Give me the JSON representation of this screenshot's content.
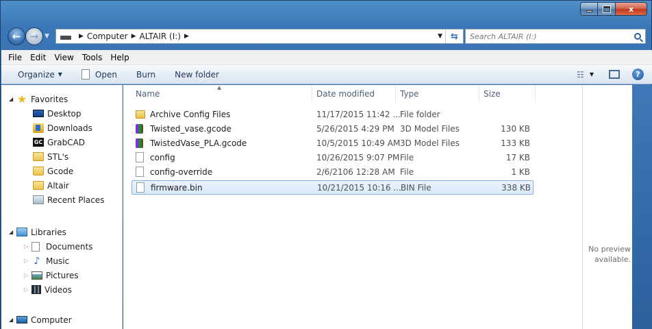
{
  "window": {
    "caption": {
      "minimize": "",
      "maximize": "",
      "close": "x"
    }
  },
  "address": {
    "crumbs": [
      "Computer",
      "ALTAIR (I:)"
    ],
    "search_placeholder": "Search ALTAIR (I:)"
  },
  "menu": [
    "File",
    "Edit",
    "View",
    "Tools",
    "Help"
  ],
  "toolbar": {
    "organize": "Organize",
    "open": "Open",
    "burn": "Burn",
    "new_folder": "New folder",
    "help": "?"
  },
  "nav": {
    "favorites_label": "Favorites",
    "favorites": [
      {
        "label": "Desktop",
        "icon": "desktop-icon"
      },
      {
        "label": "Downloads",
        "icon": "downloads-icon"
      },
      {
        "label": "GrabCAD",
        "icon": "grabcad-icon",
        "badge": "GC"
      },
      {
        "label": "STL's",
        "icon": "folder-icon"
      },
      {
        "label": "Gcode",
        "icon": "folder-icon"
      },
      {
        "label": "Altair",
        "icon": "folder-icon"
      },
      {
        "label": "Recent Places",
        "icon": "recent-places-icon"
      }
    ],
    "libraries_label": "Libraries",
    "libraries": [
      {
        "label": "Documents",
        "icon": "documents-icon"
      },
      {
        "label": "Music",
        "icon": "music-icon"
      },
      {
        "label": "Pictures",
        "icon": "pictures-icon"
      },
      {
        "label": "Videos",
        "icon": "videos-icon"
      }
    ],
    "computer_label": "Computer"
  },
  "columns": [
    "Name",
    "Date modified",
    "Type",
    "Size"
  ],
  "files": [
    {
      "name": "Archive Config Files",
      "date": "11/17/2015 11:42 ...",
      "type": "File folder",
      "size": "",
      "icon": "folder"
    },
    {
      "name": "Twisted_vase.gcode",
      "date": "5/26/2015 4:29 PM",
      "type": "3D Model Files",
      "size": "130 KB",
      "icon": "gcode"
    },
    {
      "name": "TwistedVase_PLA.gcode",
      "date": "10/5/2015 10:49 AM",
      "type": "3D Model Files",
      "size": "133 KB",
      "icon": "gcode"
    },
    {
      "name": "config",
      "date": "10/26/2015 9:07 PM",
      "type": "File",
      "size": "17 KB",
      "icon": "file"
    },
    {
      "name": "config-override",
      "date": "2/6/2106 12:28 AM",
      "type": "File",
      "size": "1 KB",
      "icon": "file"
    },
    {
      "name": "firmware.bin",
      "date": "10/21/2015 10:16 ...",
      "type": "BIN File",
      "size": "338 KB",
      "icon": "file",
      "selected": true
    }
  ],
  "preview": {
    "text": "No preview\navailable."
  }
}
